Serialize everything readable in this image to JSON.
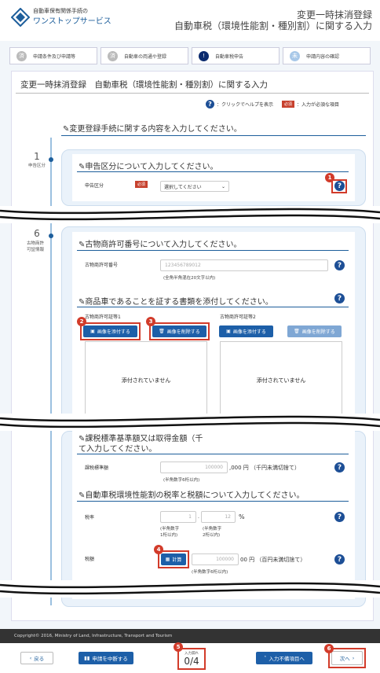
{
  "header": {
    "org_line1": "自動車保有関係手続の",
    "org_line2": "ワンストップサービス",
    "title_line1": "変更一時抹消登録",
    "title_line2": "自動車税（環境性能割・種別割）に関する入力"
  },
  "steps": [
    {
      "label": "申請条件及び申請等",
      "state": "done"
    },
    {
      "label": "自動車の両通や登録",
      "state": "done"
    },
    {
      "label": "自動車税申告",
      "state": "current"
    },
    {
      "label": "申請内容の確認",
      "state": "next"
    }
  ],
  "page_title": "変更一時抹消登録　自動車税（環境性能割・種別割）に関する入力",
  "help_hint": {
    "help_text": "：クリックでヘルプを表示",
    "required_label": "必須",
    "required_text": "：入力が必須な項目"
  },
  "section_banner": "変更登録手続に関する内容を入力してください。",
  "section1": {
    "num": "1",
    "label": "申告区分",
    "heading": "申告区分について入力してください。",
    "field_label": "申告区分",
    "required": "必須",
    "select_value": "選択してください",
    "badge": "1"
  },
  "section6": {
    "num": "6",
    "label_line1": "古物商許",
    "label_line2": "可証情報",
    "heading": "古物商許可番号について入力してください。",
    "license_label": "古物商許可番号",
    "license_placeholder": "123456789012",
    "license_note": "(全角半角混在20文字以内)",
    "doc_heading": "商品車であることを証する書類を添付してください。",
    "cert1_label": "古物商許可証等1",
    "cert2_label": "古物商許可証等2",
    "attach_label": "画像を添付する",
    "delete_label": "画像を削除する",
    "empty_text": "添付されていません",
    "badge2": "2",
    "badge3": "3"
  },
  "section_tax": {
    "heading1": "課税標準基準額又は取得金額（千",
    "heading2": "て入力してください。",
    "base_label": "課税標準額",
    "base_placeholder": "100000",
    "base_suffix": ",000 円 （千円未満切捨て）",
    "base_note": "(半角数字6桁以内)",
    "rate_heading": "自動車税環境性能割の税率と税額について入力してください。",
    "rate_label": "税率",
    "rate_int": "1",
    "rate_dec": "12",
    "rate_sep": ".",
    "rate_unit": "%",
    "rate_note1a": "(半角数字",
    "rate_note1b": "1桁以内)",
    "rate_note2a": "(半角数字",
    "rate_note2b": "2桁以内)",
    "tax_label": "税額",
    "calc_label": "計算",
    "tax_placeholder": "100000",
    "tax_suffix": "00 円 （百円未満切捨て）",
    "tax_note": "(半角数字6桁以内)",
    "badge4": "4"
  },
  "footer": {
    "copyright": "Copyright© 2016, Ministry of Land, Infrastructure, Transport and Tourism",
    "back_label": "戻る",
    "suspend_label": "申請を中断する",
    "progress_caption": "入力漏れ",
    "progress_value": "0/4",
    "error_label": "入力不備項目へ",
    "next_label": "次へ",
    "badge5": "5",
    "badge6": "6"
  },
  "colors": {
    "accent": "#1d5fa8",
    "marker": "#d23b2a",
    "required": "#c7412e"
  }
}
